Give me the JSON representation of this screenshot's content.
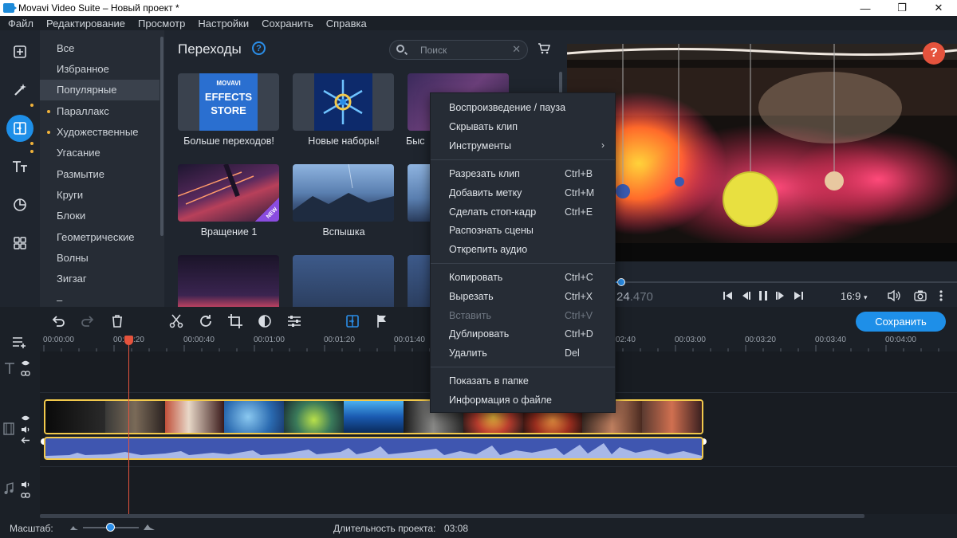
{
  "window": {
    "title": "Movavi Video Suite – Новый проект *",
    "minimize": "—",
    "maximize": "❐",
    "close": "✕"
  },
  "menu": [
    "Файл",
    "Редактирование",
    "Просмотр",
    "Настройки",
    "Сохранить",
    "Справка"
  ],
  "rail": [
    {
      "icon": "import-icon",
      "active": false,
      "dot": false
    },
    {
      "icon": "magic-wand-icon",
      "active": false,
      "dot": true
    },
    {
      "icon": "transitions-icon",
      "active": true,
      "dot": true
    },
    {
      "icon": "titles-icon",
      "active": false,
      "dot": true
    },
    {
      "icon": "stickers-icon",
      "active": false,
      "dot": false
    },
    {
      "icon": "more-tools-icon",
      "active": false,
      "dot": false
    }
  ],
  "categories": [
    {
      "label": "Все",
      "dot": false,
      "selected": false
    },
    {
      "label": "Избранное",
      "dot": false,
      "selected": false
    },
    {
      "label": "Популярные",
      "dot": false,
      "selected": true
    },
    {
      "label": "Параллакс",
      "dot": true,
      "selected": false
    },
    {
      "label": "Художественные",
      "dot": true,
      "selected": false
    },
    {
      "label": "Угасание",
      "dot": false,
      "selected": false
    },
    {
      "label": "Размытие",
      "dot": false,
      "selected": false
    },
    {
      "label": "Круги",
      "dot": false,
      "selected": false
    },
    {
      "label": "Блоки",
      "dot": false,
      "selected": false
    },
    {
      "label": "Геометрические",
      "dot": false,
      "selected": false
    },
    {
      "label": "Волны",
      "dot": false,
      "selected": false
    },
    {
      "label": "Зигзаг",
      "dot": false,
      "selected": false
    },
    {
      "label": "–",
      "dot": false,
      "selected": false
    }
  ],
  "panel": {
    "title": "Переходы",
    "help": "?",
    "search_placeholder": "Поиск",
    "search_clear": "✕",
    "tiles": [
      {
        "label": "Больше переходов!"
      },
      {
        "label": "Новые наборы!"
      },
      {
        "label": "Быс"
      },
      {
        "label": "Вращение 1",
        "badge": "NEW"
      },
      {
        "label": "Вспышка"
      },
      {
        "label": ""
      },
      {
        "label": ""
      },
      {
        "label": ""
      },
      {
        "label": ""
      }
    ],
    "store_text": [
      "MOVAVI",
      "EFFECTS",
      "STORE"
    ]
  },
  "context_menu": {
    "groups": [
      [
        {
          "label": "Воспроизведение / пауза",
          "shortcut": "",
          "submenu": false,
          "disabled": false
        },
        {
          "label": "Скрывать клип",
          "shortcut": "",
          "submenu": false,
          "disabled": false
        },
        {
          "label": "Инструменты",
          "shortcut": "",
          "submenu": true,
          "disabled": false
        }
      ],
      [
        {
          "label": "Разрезать клип",
          "shortcut": "Ctrl+B",
          "submenu": false,
          "disabled": false
        },
        {
          "label": "Добавить метку",
          "shortcut": "Ctrl+M",
          "submenu": false,
          "disabled": false
        },
        {
          "label": "Сделать стоп-кадр",
          "shortcut": "Ctrl+E",
          "submenu": false,
          "disabled": false
        },
        {
          "label": "Распознать сцены",
          "shortcut": "",
          "submenu": false,
          "disabled": false
        },
        {
          "label": "Открепить аудио",
          "shortcut": "",
          "submenu": false,
          "disabled": false
        }
      ],
      [
        {
          "label": "Копировать",
          "shortcut": "Ctrl+C",
          "submenu": false,
          "disabled": false
        },
        {
          "label": "Вырезать",
          "shortcut": "Ctrl+X",
          "submenu": false,
          "disabled": false
        },
        {
          "label": "Вставить",
          "shortcut": "Ctrl+V",
          "submenu": false,
          "disabled": true
        },
        {
          "label": "Дублировать",
          "shortcut": "Ctrl+D",
          "submenu": false,
          "disabled": false
        },
        {
          "label": "Удалить",
          "shortcut": "Del",
          "submenu": false,
          "disabled": false
        }
      ],
      [
        {
          "label": "Показать в папке",
          "shortcut": "",
          "submenu": false,
          "disabled": false
        },
        {
          "label": "Информация о файле",
          "shortcut": "",
          "submenu": false,
          "disabled": false
        }
      ]
    ]
  },
  "player": {
    "timecode_main": "24",
    "timecode_frac": ".470",
    "aspect": "16:9",
    "progress": 0.14
  },
  "toolbar": {
    "save_label": "Сохранить"
  },
  "ruler": {
    "labels": [
      "00:00:00",
      "00:00:20",
      "00:00:40",
      "00:01:00",
      "00:01:20",
      "00:01:40",
      "",
      "",
      "00:02:40",
      "00:03:00",
      "00:03:20",
      "00:03:40",
      "00:04:00"
    ]
  },
  "status": {
    "zoom_label": "Масштаб:",
    "zoom_level": 0.5,
    "duration_label": "Длительность проекта:",
    "duration_value": "03:08"
  },
  "colors": {
    "accent": "#1e8fe8",
    "playhead": "#e5533d",
    "clip_border": "#f2c94c",
    "audio": "#3f56b0"
  }
}
